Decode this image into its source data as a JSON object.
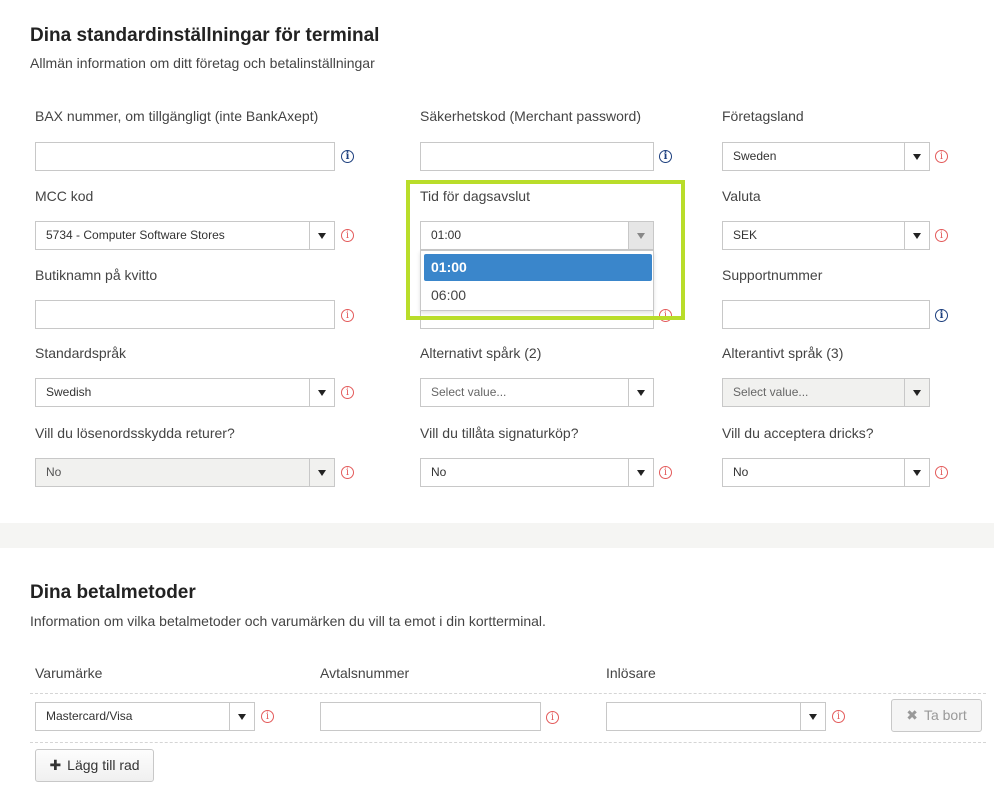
{
  "terminal": {
    "title": "Dina standardinställningar för terminal",
    "subtitle": "Allmän information om ditt företag och betalinställningar",
    "fields": {
      "bax": {
        "label": "BAX nummer, om tillgängligt (inte BankAxept)",
        "value": ""
      },
      "merchant_password": {
        "label": "Säkerhetskod (Merchant password)",
        "value": ""
      },
      "country": {
        "label": "Företagsland",
        "value": "Sweden"
      },
      "mcc": {
        "label": "MCC kod",
        "value": "5734 - Computer Software Stores"
      },
      "closing_time": {
        "label": "Tid för dagsavslut",
        "value": "01:00",
        "options": [
          "01:00",
          "06:00"
        ]
      },
      "currency": {
        "label": "Valuta",
        "value": "SEK"
      },
      "store_name": {
        "label": "Butiknamn på kvitto",
        "value": ""
      },
      "support_number": {
        "label": "Supportnummer",
        "value": ""
      },
      "default_language": {
        "label": "Standardspråk",
        "value": "Swedish"
      },
      "alt_language_2": {
        "label": "Alternativt spårk (2)",
        "placeholder": "Select value..."
      },
      "alt_language_3": {
        "label": "Alterantivt språk (3)",
        "placeholder": "Select value..."
      },
      "password_returns": {
        "label": "Vill du lösenordsskydda returer?",
        "value": "No"
      },
      "signature_purchase": {
        "label": "Vill du tillåta signaturköp?",
        "value": "No"
      },
      "tips": {
        "label": "Vill du acceptera dricks?",
        "value": "No"
      }
    }
  },
  "payment": {
    "title": "Dina betalmetoder",
    "subtitle": "Information om vilka betalmetoder och varumärken du vill ta emot i din kortterminal.",
    "columns": {
      "brand": "Varumärke",
      "agreement": "Avtalsnummer",
      "acquirer": "Inlösare"
    },
    "rows": [
      {
        "brand": "Mastercard/Visa",
        "agreement": "",
        "acquirer": ""
      }
    ],
    "remove_label": "Ta bort",
    "add_row_label": "Lägg till rad"
  },
  "icons": {
    "info": "i",
    "warn": "i",
    "remove": "✖",
    "add": "✚"
  },
  "colors": {
    "highlight": "#b9dd2a",
    "selected_option": "#3a86cb",
    "info_icon": "#1d3f7e",
    "warn_icon": "#e35b5b"
  }
}
